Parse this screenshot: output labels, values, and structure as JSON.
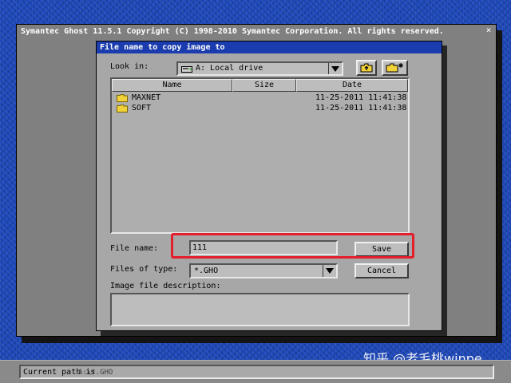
{
  "main_window": {
    "title": "Symantec Ghost 11.5.1   Copyright (C) 1998-2010 Symantec Corporation. All rights reserved.",
    "close_glyph": "×"
  },
  "dialog": {
    "title": "File name to copy image to",
    "look_in_label": "Look in:",
    "look_in_value": "A: Local drive",
    "look_in_icon": "drive-icon",
    "toolbar": {
      "up_folder_icon": "up-folder-icon",
      "new_folder_icon": "new-folder-icon"
    },
    "file_list": {
      "columns": [
        "Name",
        "Size",
        "Date"
      ],
      "rows": [
        {
          "name": "MAXNET",
          "size": "",
          "date": "11-25-2011 11:41:38",
          "icon": "folder-icon"
        },
        {
          "name": "SOFT",
          "size": "",
          "date": "11-25-2011 11:41:38",
          "icon": "folder-icon"
        }
      ]
    },
    "file_name_label": "File name:",
    "file_name_value": "111",
    "save_label": "Save",
    "files_of_type_label": "Files of type:",
    "files_of_type_value": "*.GHO",
    "cancel_label": "Cancel",
    "description_label": "Image file description:",
    "description_value": ""
  },
  "status_bar": {
    "label": "Current path is",
    "value": "A:\\*.GHO"
  },
  "watermark": "知乎 @老毛桃winpe",
  "colors": {
    "desktop": "#1c47b8",
    "dialog_titlebar": "#1a3cae",
    "highlight": "#e41e2a"
  }
}
